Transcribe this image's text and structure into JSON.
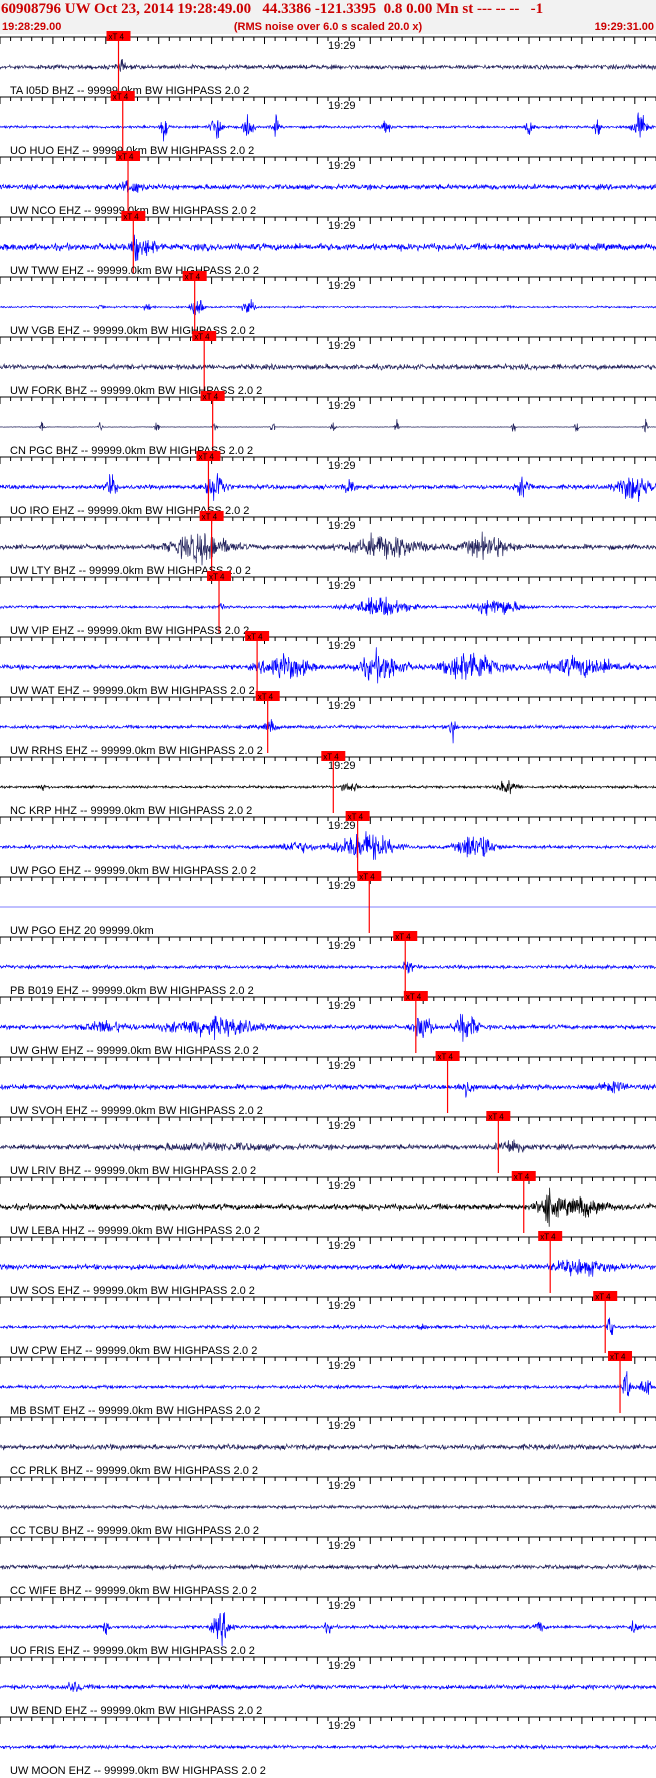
{
  "header": {
    "title": "60908796 UW Oct 23, 2014 19:28:49.00   44.3386 -121.3395  0.8 0.00 Mn st --- -- --   -1",
    "start_time": "19:28:29.00",
    "scaling_note": "(RMS noise over 6.0 s scaled 20.0 x)",
    "end_time": "19:29:31.00"
  },
  "chart_data": {
    "type": "line",
    "title": "60908796 UW Oct 23, 2014 19:28:49.00   44.3386 -121.3395  0.8 0.00 Mn st --- -- --   -1",
    "xlabel": "",
    "ylabel": "",
    "x_range": [
      "19:28:29.00",
      "19:29:31.00"
    ],
    "grid": false,
    "time_tick_label": "19:29",
    "pick_label": "xT 4",
    "colors": {
      "blue": "#0000ff",
      "navy": "#22225c",
      "black": "#000000",
      "pick": "#ff0000",
      "header": "#cc0000"
    },
    "traces": [
      {
        "label": "TA I05D BHZ -- 99999.0km BW  HIGHPASS  2.0  2",
        "color": "navy",
        "pick_s": 11.2,
        "amp": 0.25,
        "bursts": [
          [
            11.4,
            0.5,
            0.5
          ]
        ]
      },
      {
        "label": "UO HUO EHZ -- 99999.0km BW  HIGHPASS  2.0  2",
        "color": "blue",
        "pick_s": 11.6,
        "amp": 0.15,
        "bursts": [
          [
            15.5,
            0.3,
            1.8
          ],
          [
            20.5,
            0.5,
            1.7
          ],
          [
            23.5,
            0.4,
            1.6
          ],
          [
            26.0,
            0.3,
            1.3
          ],
          [
            36.5,
            0.3,
            1.0
          ],
          [
            50.0,
            0.3,
            1.3
          ],
          [
            56.5,
            0.3,
            1.4
          ],
          [
            60.5,
            0.6,
            1.5
          ]
        ]
      },
      {
        "label": "UW NCO EHZ -- 99999.0km BW  HIGHPASS  2.0  2",
        "color": "blue",
        "pick_s": 12.1,
        "amp": 0.3,
        "bursts": [
          [
            12.4,
            1.0,
            0.6
          ]
        ]
      },
      {
        "label": "UW TWW EHZ -- 99999.0km BW  HIGHPASS  2.0  2",
        "color": "blue",
        "pick_s": 12.6,
        "amp": 0.4,
        "bursts": [
          [
            12.9,
            0.4,
            1.2
          ],
          [
            14.0,
            1.0,
            0.7
          ]
        ]
      },
      {
        "label": "UW VGB EHZ -- 99999.0km BW  HIGHPASS  2.0  2",
        "color": "blue",
        "pick_s": 18.4,
        "amp": 0.1,
        "bursts": [
          [
            14.0,
            0.4,
            0.6
          ],
          [
            18.6,
            0.5,
            1.5
          ],
          [
            23.5,
            0.6,
            0.8
          ],
          [
            9.5,
            0.3,
            0.3
          ],
          [
            48.0,
            0.3,
            0.3
          ]
        ]
      },
      {
        "label": "UW FORK BHZ -- 99999.0km BW  HIGHPASS  2.0  2",
        "color": "navy",
        "pick_s": 19.3,
        "amp": 0.3,
        "bursts": []
      },
      {
        "label": "CN PGC BHZ -- 99999.0km BW  HIGHPASS  2.0  2",
        "color": "navy",
        "pick_s": 20.1,
        "amp": 0.03,
        "bursts": [
          [
            4.0,
            0.2,
            0.8
          ],
          [
            9.5,
            0.2,
            0.8
          ],
          [
            14.8,
            0.2,
            0.8
          ],
          [
            20.3,
            0.2,
            0.8
          ],
          [
            25.8,
            0.2,
            0.8
          ],
          [
            31.5,
            0.2,
            0.8
          ],
          [
            37.5,
            0.2,
            0.8
          ],
          [
            48.5,
            0.2,
            0.8
          ],
          [
            54.5,
            0.2,
            0.8
          ],
          [
            61.0,
            0.2,
            0.8
          ]
        ]
      },
      {
        "label": "UO IRO EHZ -- 99999.0km BW  HIGHPASS  2.0  2",
        "color": "blue",
        "pick_s": 19.7,
        "amp": 0.25,
        "bursts": [
          [
            20.3,
            0.9,
            2.0
          ],
          [
            10.5,
            0.5,
            1.2
          ],
          [
            33.0,
            0.4,
            1.0
          ],
          [
            49.5,
            0.6,
            1.2
          ],
          [
            60.0,
            1.5,
            1.5
          ]
        ]
      },
      {
        "label": "UW LTY BHZ -- 99999.0km BW  HIGHPASS  2.0  2",
        "color": "navy",
        "pick_s": 20.0,
        "amp": 0.3,
        "bursts": [
          [
            19.0,
            2.5,
            1.6
          ],
          [
            36.5,
            3.0,
            1.3
          ],
          [
            46.0,
            2.0,
            1.2
          ]
        ]
      },
      {
        "label": "UW VIP EHZ -- 99999.0km BW  HIGHPASS  2.0  2",
        "color": "blue",
        "pick_s": 20.7,
        "amp": 0.15,
        "bursts": [
          [
            36.0,
            2.5,
            1.1
          ],
          [
            47.0,
            2.0,
            1.0
          ],
          [
            21.0,
            0.3,
            0.5
          ]
        ]
      },
      {
        "label": "UW WAT EHZ -- 99999.0km BW  HIGHPASS  2.0  2",
        "color": "blue",
        "pick_s": 24.3,
        "amp": 0.25,
        "bursts": [
          [
            27.0,
            2.0,
            1.5
          ],
          [
            36.0,
            2.0,
            1.6
          ],
          [
            44.5,
            2.2,
            1.9
          ],
          [
            55.0,
            3.5,
            1.0
          ]
        ]
      },
      {
        "label": "UW RRHS EHZ -- 99999.0km BW  HIGHPASS  2.0  2",
        "color": "blue",
        "pick_s": 25.3,
        "amp": 0.2,
        "bursts": [
          [
            25.5,
            0.5,
            0.8
          ],
          [
            42.8,
            0.3,
            1.5
          ]
        ]
      },
      {
        "label": "NC KRP HHZ -- 99999.0km BW  HIGHPASS  2.0  2",
        "color": "black",
        "pick_s": 31.5,
        "amp": 0.15,
        "bursts": [
          [
            33.0,
            0.7,
            0.7
          ],
          [
            48.0,
            0.8,
            0.8
          ],
          [
            4.0,
            0.3,
            0.3
          ]
        ]
      },
      {
        "label": "UW PGO EHZ -- 99999.0km BW  HIGHPASS  2.0  2",
        "color": "blue",
        "pick_s": 33.8,
        "amp": 0.2,
        "bursts": [
          [
            34.5,
            2.5,
            1.6
          ],
          [
            45.0,
            1.5,
            1.7
          ],
          [
            28.0,
            1.5,
            0.6
          ]
        ]
      },
      {
        "label": "UW PGO EHZ 20 99999.0km",
        "color": "blue",
        "pick_s": 34.9,
        "amp": 0.0,
        "bursts": []
      },
      {
        "label": "PB B019 EHZ -- 99999.0km BW  HIGHPASS  2.0  2",
        "color": "blue",
        "pick_s": 38.3,
        "amp": 0.2,
        "bursts": [
          [
            38.6,
            0.5,
            0.7
          ]
        ]
      },
      {
        "label": "UW GHW EHZ -- 99999.0km BW  HIGHPASS  2.0  2",
        "color": "blue",
        "pick_s": 39.3,
        "amp": 0.25,
        "bursts": [
          [
            20.0,
            4.0,
            1.0
          ],
          [
            40.0,
            0.8,
            1.5
          ],
          [
            44.0,
            1.0,
            1.6
          ],
          [
            10.0,
            2.0,
            0.6
          ]
        ]
      },
      {
        "label": "UW SVOH EHZ -- 99999.0km BW  HIGHPASS  2.0  2",
        "color": "blue",
        "pick_s": 42.3,
        "amp": 0.3,
        "bursts": [
          [
            44.0,
            0.6,
            0.9
          ],
          [
            58.0,
            1.0,
            0.5
          ]
        ]
      },
      {
        "label": "UW LRIV BHZ -- 99999.0km BW  HIGHPASS  2.0  2",
        "color": "navy",
        "pick_s": 47.1,
        "amp": 0.3,
        "bursts": [
          [
            48.5,
            1.2,
            0.8
          ],
          [
            20.0,
            6.0,
            0.3
          ]
        ]
      },
      {
        "label": "UW LEBA HHZ -- 99999.0km BW  HIGHPASS  2.0  2",
        "color": "black",
        "pick_s": 49.5,
        "amp": 0.35,
        "bursts": [
          [
            51.8,
            0.8,
            1.9
          ],
          [
            55.0,
            2.0,
            1.0
          ]
        ]
      },
      {
        "label": "UW SOS EHZ -- 99999.0km BW  HIGHPASS  2.0  2",
        "color": "blue",
        "pick_s": 52.0,
        "amp": 0.3,
        "bursts": [
          [
            55.0,
            2.5,
            0.8
          ]
        ]
      },
      {
        "label": "UW CPW EHZ -- 99999.0km BW  HIGHPASS  2.0  2",
        "color": "blue",
        "pick_s": 57.2,
        "amp": 0.2,
        "bursts": [
          [
            57.6,
            0.3,
            1.6
          ],
          [
            40.0,
            0.3,
            0.4
          ]
        ]
      },
      {
        "label": "MB BSMT EHZ -- 99999.0km BW  HIGHPASS  2.0  2",
        "color": "blue",
        "pick_s": 58.6,
        "amp": 0.2,
        "bursts": [
          [
            59.2,
            0.3,
            2.0
          ],
          [
            61.0,
            0.5,
            1.2
          ]
        ]
      },
      {
        "label": "CC PRLK BHZ -- 99999.0km BW  HIGHPASS  2.0  2",
        "color": "navy",
        "pick_s": null,
        "amp": 0.3,
        "bursts": []
      },
      {
        "label": "CC TCBU BHZ -- 99999.0km BW  HIGHPASS  2.0  2",
        "color": "navy",
        "pick_s": null,
        "amp": 0.2,
        "bursts": []
      },
      {
        "label": "CC WIFE BHZ -- 99999.0km BW  HIGHPASS  2.0  2",
        "color": "navy",
        "pick_s": null,
        "amp": 0.25,
        "bursts": []
      },
      {
        "label": "UO FRIS EHZ -- 99999.0km BW  HIGHPASS  2.0  2",
        "color": "blue",
        "pick_s": null,
        "amp": 0.2,
        "bursts": [
          [
            21.0,
            0.8,
            1.6
          ],
          [
            10.0,
            0.3,
            0.8
          ],
          [
            31.0,
            0.3,
            0.6
          ],
          [
            51.0,
            0.3,
            0.9
          ],
          [
            60.0,
            0.4,
            0.9
          ]
        ]
      },
      {
        "label": "UW BEND EHZ -- 99999.0km BW  HIGHPASS  2.0  2",
        "color": "blue",
        "pick_s": null,
        "amp": 0.25,
        "bursts": [
          [
            7.0,
            0.8,
            0.5
          ]
        ]
      },
      {
        "label": "UW MOON EHZ -- 99999.0km BW  HIGHPASS  2.0  2",
        "color": "blue",
        "pick_s": null,
        "amp": 0.2,
        "bursts": []
      }
    ]
  }
}
